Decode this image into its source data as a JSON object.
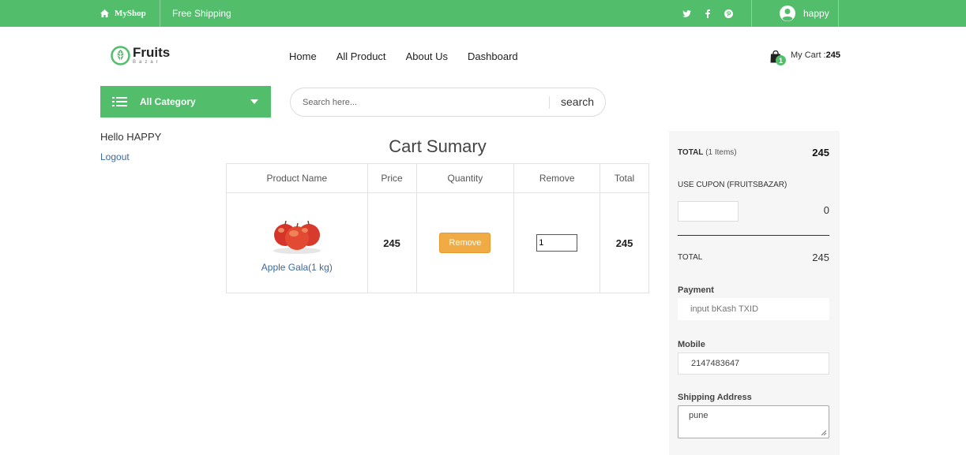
{
  "topbar": {
    "shop_name": "MyShop",
    "shipping": "Free Shipping",
    "username": "happy",
    "social_icons": [
      "twitter-icon",
      "facebook-icon",
      "pinterest-icon"
    ],
    "bg_color": "#52bd6b"
  },
  "header": {
    "logo_name": "Fruits",
    "logo_sub": "Bazar",
    "nav": [
      "Home",
      "All Product",
      "About Us",
      "Dashboard"
    ],
    "cart_count": "1",
    "cart_label": "My Cart :",
    "cart_total": "245"
  },
  "category": {
    "label": "All Category"
  },
  "search": {
    "placeholder": "Search here...",
    "button": "search"
  },
  "sidebar": {
    "greeting": "Hello HAPPY",
    "logout": "Logout"
  },
  "cart": {
    "title": "Cart Sumary",
    "columns": [
      "Product Name",
      "Price",
      "Quantity",
      "Remove",
      "Total"
    ],
    "rows": [
      {
        "product": "Apple Gala(1 kg)",
        "price": "245",
        "remove_label": "Remove",
        "quantity": "1",
        "total": "245"
      }
    ]
  },
  "summary": {
    "total_label": "TOTAL",
    "items_note": "(1 Items)",
    "total_value": "245",
    "coupon_label": "USE CUPON (FRUITSBAZAR)",
    "coupon_value": "0",
    "grand_total_label": "TOTAL",
    "grand_total_value": "245",
    "payment_label": "Payment",
    "payment_placeholder": "input bKash TXID",
    "mobile_label": "Mobile",
    "mobile_value": "2147483647",
    "address_label": "Shipping Address",
    "address_value": "pune"
  }
}
